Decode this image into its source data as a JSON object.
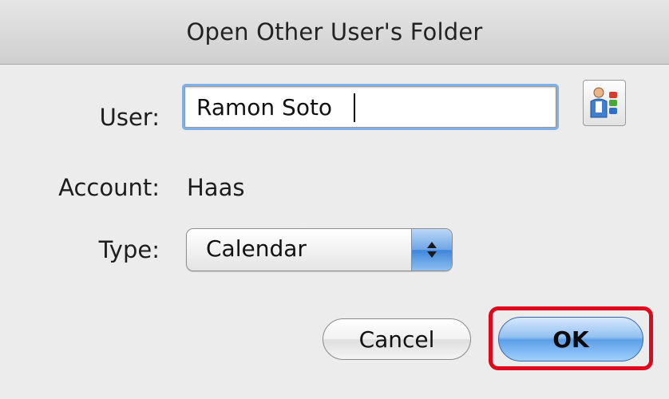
{
  "dialog": {
    "title": "Open Other User's Folder",
    "user_label": "User:",
    "user_value": "Ramon Soto",
    "account_label": "Account:",
    "account_value": "Haas",
    "type_label": "Type:",
    "type_selected": "Calendar",
    "cancel_label": "Cancel",
    "ok_label": "OK"
  },
  "icons": {
    "address_book": "address-book-icon",
    "popup_arrows": "up-down-arrows-icon"
  },
  "colors": {
    "focus_ring": "#7fb0e8",
    "default_button": "#5c9fe8",
    "highlight": "#e0081c"
  }
}
